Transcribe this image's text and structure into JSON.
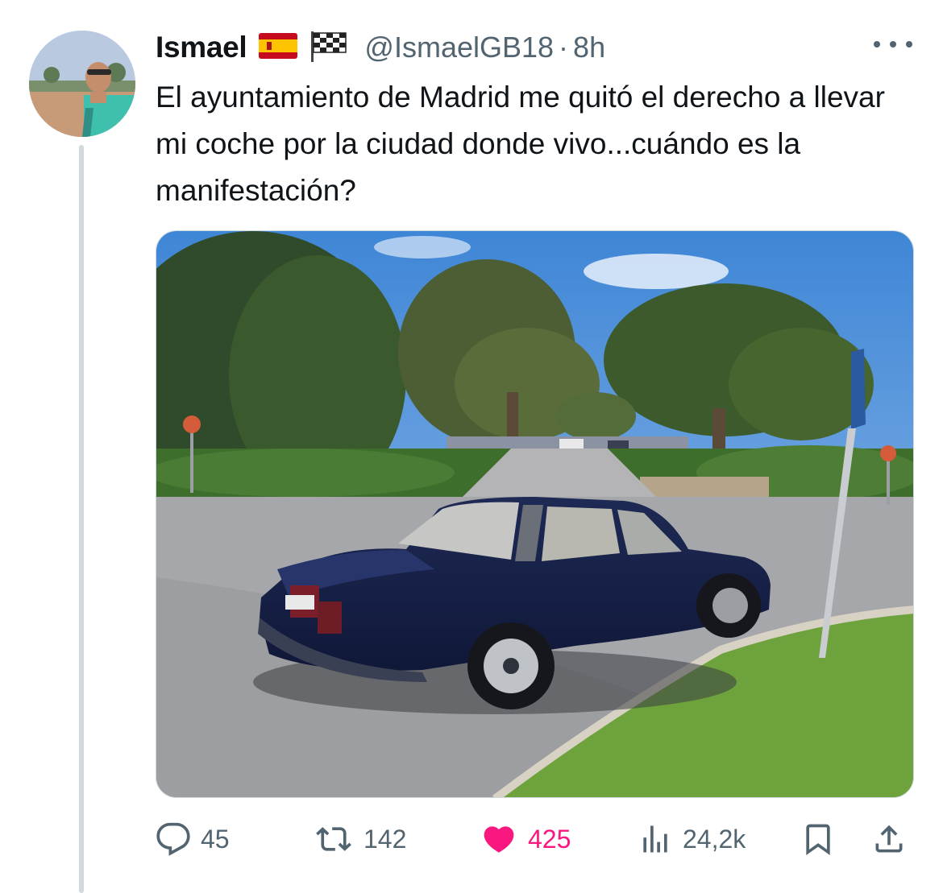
{
  "author": {
    "display_name": "Ismael",
    "flags": [
      "flag-spain-icon",
      "checkered-flag-icon"
    ],
    "handle": "@IsmaelGB18",
    "separator": "·",
    "timestamp": "8h"
  },
  "tweet": {
    "text": "El ayuntamiento de Madrid me quitó el derecho a llevar mi coche por la ciudad donde vivo...cuándo es la manifestación?"
  },
  "actions": {
    "replies": "45",
    "retweets": "142",
    "likes": "425",
    "views": "24,2k"
  },
  "colors": {
    "like_active": "#f91880",
    "icon_gray": "#536471",
    "thread_line": "#cfd9de"
  },
  "icons": [
    "more-icon",
    "reply-icon",
    "retweet-icon",
    "heart-icon",
    "views-icon",
    "bookmark-icon",
    "share-icon"
  ]
}
